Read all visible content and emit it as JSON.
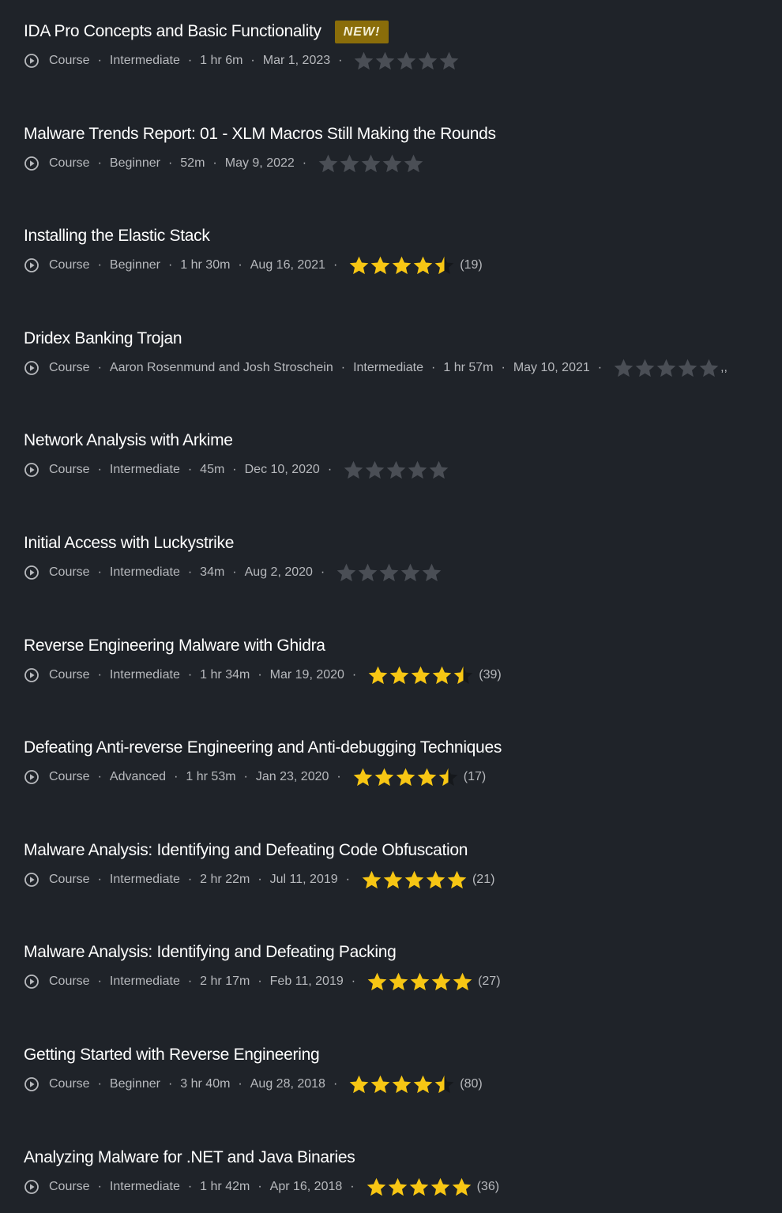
{
  "colors": {
    "background": "#1f2329",
    "star_filled": "#f7c614",
    "star_empty": "#4a4e55",
    "badge": "#8a6d0a",
    "meta_text": "#b7b9bd"
  },
  "courses": [
    {
      "title": "IDA Pro Concepts and Basic Functionality",
      "badge": "NEW!",
      "meta": [
        "Course",
        "Intermediate",
        "1 hr 6m",
        "Mar 1, 2023"
      ],
      "rating": 0,
      "count": ""
    },
    {
      "title": "Malware Trends Report: 01 - XLM Macros Still Making the Rounds",
      "badge": "",
      "meta": [
        "Course",
        "Beginner",
        "52m",
        "May 9, 2022"
      ],
      "rating": 0,
      "count": ""
    },
    {
      "title": "Installing the Elastic Stack",
      "badge": "",
      "meta": [
        "Course",
        "Beginner",
        "1 hr 30m",
        "Aug 16, 2021"
      ],
      "rating": 4.5,
      "count": "(19)"
    },
    {
      "title": "Dridex Banking Trojan",
      "badge": "",
      "meta": [
        "Course",
        "Aaron Rosenmund and Josh Stroschein",
        "Intermediate",
        "1 hr 57m",
        "May 10, 2021"
      ],
      "rating": 0,
      "count": "",
      "trail": ",,"
    },
    {
      "title": "Network Analysis with Arkime",
      "badge": "",
      "meta": [
        "Course",
        "Intermediate",
        "45m",
        "Dec 10, 2020"
      ],
      "rating": 0,
      "count": ""
    },
    {
      "title": "Initial Access with Luckystrike",
      "badge": "",
      "meta": [
        "Course",
        "Intermediate",
        "34m",
        "Aug 2, 2020"
      ],
      "rating": 0,
      "count": ""
    },
    {
      "title": "Reverse Engineering Malware with Ghidra",
      "badge": "",
      "meta": [
        "Course",
        "Intermediate",
        "1 hr 34m",
        "Mar 19, 2020"
      ],
      "rating": 4.5,
      "count": "(39)"
    },
    {
      "title": "Defeating Anti-reverse Engineering and Anti-debugging Techniques",
      "badge": "",
      "meta": [
        "Course",
        "Advanced",
        "1 hr 53m",
        "Jan 23, 2020"
      ],
      "rating": 4.5,
      "count": "(17)"
    },
    {
      "title": "Malware Analysis: Identifying and Defeating Code Obfuscation",
      "badge": "",
      "meta": [
        "Course",
        "Intermediate",
        "2 hr 22m",
        "Jul 11, 2019"
      ],
      "rating": 5,
      "count": "(21)"
    },
    {
      "title": "Malware Analysis: Identifying and Defeating Packing",
      "badge": "",
      "meta": [
        "Course",
        "Intermediate",
        "2 hr 17m",
        "Feb 11, 2019"
      ],
      "rating": 5,
      "count": "(27)"
    },
    {
      "title": "Getting Started with Reverse Engineering",
      "badge": "",
      "meta": [
        "Course",
        "Beginner",
        "3 hr 40m",
        "Aug 28, 2018"
      ],
      "rating": 4.5,
      "count": "(80)"
    },
    {
      "title": "Analyzing Malware for .NET and Java Binaries",
      "badge": "",
      "meta": [
        "Course",
        "Intermediate",
        "1 hr 42m",
        "Apr 16, 2018"
      ],
      "rating": 5,
      "count": "(36)"
    }
  ]
}
